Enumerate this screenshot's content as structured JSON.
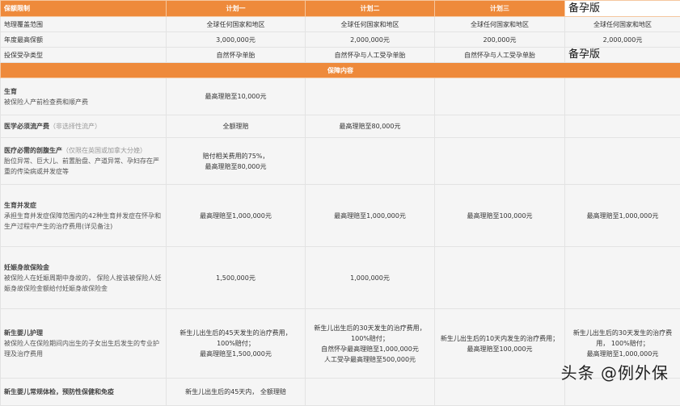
{
  "header": [
    "保额限制",
    "计划一",
    "计划二",
    "计划三",
    "备孕版"
  ],
  "basic_rows": [
    {
      "label": "地理覆盖范围",
      "values": [
        "全球任何国家和地区",
        "全球任何国家和地区",
        "全球任何国家和地区",
        "全球任何国家和地区"
      ]
    },
    {
      "label": "年度最高保额",
      "values": [
        "3,000,000元",
        "2,000,000元",
        "200,000元",
        "2,000,000元"
      ]
    },
    {
      "label": "投保受孕类型",
      "values": [
        "自然怀孕单胎",
        "自然怀孕与人工受孕单胎",
        "自然怀孕与人工受孕单胎",
        "备孕版"
      ]
    }
  ],
  "section_title": "保障内容",
  "coverage_rows": [
    {
      "title": "生育",
      "note": "",
      "desc": "被保险人产前检查费和顺产费",
      "values": [
        "最高理赔至10,000元",
        "",
        "",
        ""
      ]
    },
    {
      "title": "医学必须流产费",
      "note": "（非选择性流产）",
      "desc": "",
      "values": [
        "全额理赔",
        "最高理赔至80,000元",
        "",
        ""
      ]
    },
    {
      "title": "医疗必需的剖腹生产",
      "note": "（仅限在英国或加拿大分娩）",
      "desc": "胎位异常、巨大儿、前置胎盘、产道异常、孕妇存在严重的传染病或并发症等",
      "values": [
        "赔付相关费用的75%，\n最高理赔至80,000元",
        "",
        "",
        ""
      ]
    },
    {
      "title": "生育并发症",
      "note": "",
      "desc": "承担生育并发症保障范围内的42种生育并发症在怀孕和生产过程中产生的治疗费用(详见备注)",
      "values": [
        "最高理赔至1,000,000元",
        "最高理赔至1,000,000元",
        "最高理赔至100,000元",
        "最高理赔至1,000,000元"
      ]
    },
    {
      "title": "妊娠身故保险金",
      "note": "",
      "desc": "被保险人在妊娠周期中身故的， 保险人按该被保险人妊娠身故保险金额给付妊娠身故保险金",
      "values": [
        "1,500,000元",
        "1,000,000元",
        "",
        ""
      ]
    },
    {
      "title": "新生婴儿护理",
      "note": "",
      "desc": "被保险人在保险期间内出生的子女出生后发生的专业护理及治疗费用",
      "values": [
        "新生儿出生后的45天发生的治疗费用， 100%赔付；\n最高理赔至1,500,000元",
        "新生儿出生后的30天发生的治疗费用， 100%赔付；\n自然怀孕最高理赔至1,000,000元\n人工受孕最高理赔至500,000元",
        "新生儿出生后的10天内发生的治疗费用；\n最高理赔至100,000元",
        "新生儿出生后的30天发生的治疗费用， 100%赔付；\n最高理赔至1,000,000元"
      ]
    },
    {
      "title": "新生婴儿常规体检，预防性保健和免疫",
      "note": "",
      "desc": "",
      "values": [
        "新生儿出生后的45天内，  全额理赔",
        "",
        "",
        ""
      ]
    }
  ],
  "watermark": "头条 @例外保"
}
